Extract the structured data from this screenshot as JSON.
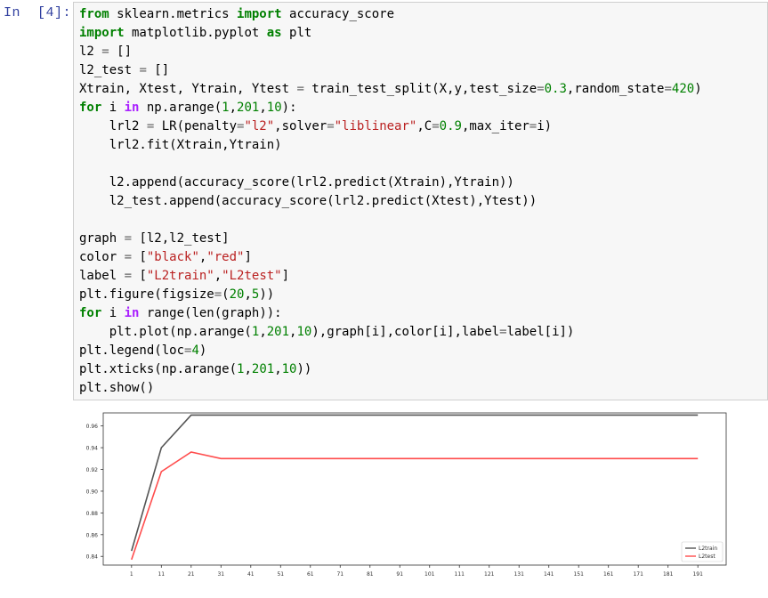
{
  "cell": {
    "prompt": "In  [4]:",
    "lines": [
      [
        {
          "t": "from",
          "c": "kw"
        },
        {
          "t": " sklearn.metrics "
        },
        {
          "t": "import",
          "c": "kw"
        },
        {
          "t": " accuracy_score"
        }
      ],
      [
        {
          "t": "import",
          "c": "kw"
        },
        {
          "t": " matplotlib.pyplot "
        },
        {
          "t": "as",
          "c": "kw"
        },
        {
          "t": " plt"
        }
      ],
      [
        {
          "t": "l2 "
        },
        {
          "t": "=",
          "c": "op"
        },
        {
          "t": " []"
        }
      ],
      [
        {
          "t": "l2_test "
        },
        {
          "t": "=",
          "c": "op"
        },
        {
          "t": " []"
        }
      ],
      [
        {
          "t": "Xtrain, Xtest, Ytrain, Ytest "
        },
        {
          "t": "=",
          "c": "op"
        },
        {
          "t": " train_test_split(X,y,test_size"
        },
        {
          "t": "=",
          "c": "op"
        },
        {
          "t": "0.3",
          "c": "num"
        },
        {
          "t": ",random_state"
        },
        {
          "t": "=",
          "c": "op"
        },
        {
          "t": "420",
          "c": "num"
        },
        {
          "t": ")"
        }
      ],
      [
        {
          "t": "for",
          "c": "kw"
        },
        {
          "t": " i "
        },
        {
          "t": "in",
          "c": "op-word"
        },
        {
          "t": " np.arange("
        },
        {
          "t": "1",
          "c": "num"
        },
        {
          "t": ","
        },
        {
          "t": "201",
          "c": "num"
        },
        {
          "t": ","
        },
        {
          "t": "10",
          "c": "num"
        },
        {
          "t": "):"
        }
      ],
      [
        {
          "t": "    lrl2 "
        },
        {
          "t": "=",
          "c": "op"
        },
        {
          "t": " LR(penalty"
        },
        {
          "t": "=",
          "c": "op"
        },
        {
          "t": "\"l2\"",
          "c": "str"
        },
        {
          "t": ",solver"
        },
        {
          "t": "=",
          "c": "op"
        },
        {
          "t": "\"liblinear\"",
          "c": "str"
        },
        {
          "t": ",C"
        },
        {
          "t": "=",
          "c": "op"
        },
        {
          "t": "0.9",
          "c": "num"
        },
        {
          "t": ",max_iter"
        },
        {
          "t": "=",
          "c": "op"
        },
        {
          "t": "i)"
        }
      ],
      [
        {
          "t": "    lrl2.fit(Xtrain,Ytrain)"
        }
      ],
      [
        {
          "t": ""
        }
      ],
      [
        {
          "t": "    l2.append(accuracy_score(lrl2.predict(Xtrain),Ytrain))"
        }
      ],
      [
        {
          "t": "    l2_test.append(accuracy_score(lrl2.predict(Xtest),Ytest))"
        }
      ],
      [
        {
          "t": ""
        }
      ],
      [
        {
          "t": "graph "
        },
        {
          "t": "=",
          "c": "op"
        },
        {
          "t": " [l2,l2_test]"
        }
      ],
      [
        {
          "t": "color "
        },
        {
          "t": "=",
          "c": "op"
        },
        {
          "t": " ["
        },
        {
          "t": "\"black\"",
          "c": "str"
        },
        {
          "t": ","
        },
        {
          "t": "\"red\"",
          "c": "str"
        },
        {
          "t": "]"
        }
      ],
      [
        {
          "t": "label "
        },
        {
          "t": "=",
          "c": "op"
        },
        {
          "t": " ["
        },
        {
          "t": "\"L2train\"",
          "c": "str"
        },
        {
          "t": ","
        },
        {
          "t": "\"L2test\"",
          "c": "str"
        },
        {
          "t": "]"
        }
      ],
      [
        {
          "t": "plt.figure(figsize"
        },
        {
          "t": "=",
          "c": "op"
        },
        {
          "t": "("
        },
        {
          "t": "20",
          "c": "num"
        },
        {
          "t": ","
        },
        {
          "t": "5",
          "c": "num"
        },
        {
          "t": "))"
        }
      ],
      [
        {
          "t": "for",
          "c": "kw"
        },
        {
          "t": " i "
        },
        {
          "t": "in",
          "c": "op-word"
        },
        {
          "t": " range(len(graph)):"
        }
      ],
      [
        {
          "t": "    plt.plot(np.arange("
        },
        {
          "t": "1",
          "c": "num"
        },
        {
          "t": ","
        },
        {
          "t": "201",
          "c": "num"
        },
        {
          "t": ","
        },
        {
          "t": "10",
          "c": "num"
        },
        {
          "t": "),graph[i],color[i],label"
        },
        {
          "t": "=",
          "c": "op"
        },
        {
          "t": "label[i])"
        }
      ],
      [
        {
          "t": "plt.legend(loc"
        },
        {
          "t": "=",
          "c": "op"
        },
        {
          "t": "4",
          "c": "num"
        },
        {
          "t": ")"
        }
      ],
      [
        {
          "t": "plt.xticks(np.arange("
        },
        {
          "t": "1",
          "c": "num"
        },
        {
          "t": ","
        },
        {
          "t": "201",
          "c": "num"
        },
        {
          "t": ","
        },
        {
          "t": "10",
          "c": "num"
        },
        {
          "t": "))"
        }
      ],
      [
        {
          "t": "plt.show()"
        }
      ]
    ]
  },
  "chart_data": {
    "type": "line",
    "x": [
      1,
      11,
      21,
      31,
      41,
      51,
      61,
      71,
      81,
      91,
      101,
      111,
      121,
      131,
      141,
      151,
      161,
      171,
      181,
      191
    ],
    "xticks": [
      "1",
      "11",
      "21",
      "31",
      "41",
      "51",
      "61",
      "71",
      "81",
      "91",
      "101",
      "111",
      "121",
      "131",
      "141",
      "151",
      "161",
      "171",
      "181",
      "191"
    ],
    "yticks": [
      "0.84",
      "0.86",
      "0.88",
      "0.90",
      "0.92",
      "0.94",
      "0.96"
    ],
    "ylim": [
      0.832,
      0.972
    ],
    "xlim": [
      -8.5,
      200.5
    ],
    "series": [
      {
        "name": "L2train",
        "color": "#555555",
        "values": [
          0.845,
          0.94,
          0.97,
          0.97,
          0.97,
          0.97,
          0.97,
          0.97,
          0.97,
          0.97,
          0.97,
          0.97,
          0.97,
          0.97,
          0.97,
          0.97,
          0.97,
          0.97,
          0.97,
          0.97
        ]
      },
      {
        "name": "L2test",
        "color": "#ff4d4d",
        "values": [
          0.837,
          0.918,
          0.936,
          0.93,
          0.93,
          0.93,
          0.93,
          0.93,
          0.93,
          0.93,
          0.93,
          0.93,
          0.93,
          0.93,
          0.93,
          0.93,
          0.93,
          0.93,
          0.93,
          0.93
        ]
      }
    ],
    "legend_position": "lower-right",
    "grid": false
  }
}
